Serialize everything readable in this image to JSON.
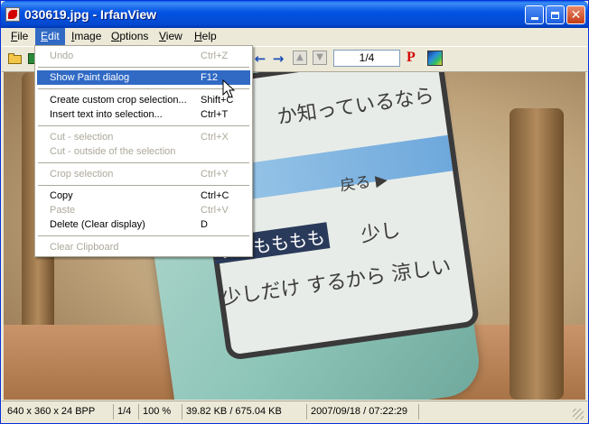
{
  "window": {
    "title": "030619.jpg - IrfanView"
  },
  "menubar": {
    "items": [
      {
        "label": "File",
        "accel": "F",
        "rest": "ile"
      },
      {
        "label": "Edit",
        "accel": "E",
        "rest": "dit"
      },
      {
        "label": "Image",
        "accel": "I",
        "rest": "mage"
      },
      {
        "label": "Options",
        "accel": "O",
        "rest": "ptions"
      },
      {
        "label": "View",
        "accel": "V",
        "rest": "iew"
      },
      {
        "label": "Help",
        "accel": "H",
        "rest": "elp"
      }
    ]
  },
  "toolbar": {
    "page_indicator": "1/4",
    "p_label": "P"
  },
  "edit_menu": {
    "items": [
      {
        "label": "Undo",
        "shortcut": "Ctrl+Z",
        "enabled": false
      },
      {
        "label": "Show Paint dialog",
        "shortcut": "F12",
        "enabled": true,
        "highlighted": true
      },
      {
        "label": "Create custom crop selection...",
        "shortcut": "Shift+C",
        "enabled": true
      },
      {
        "label": "Insert text into selection...",
        "shortcut": "Ctrl+T",
        "enabled": true
      },
      {
        "label": "Cut - selection",
        "shortcut": "Ctrl+X",
        "enabled": false
      },
      {
        "label": "Cut - outside of the selection",
        "shortcut": "",
        "enabled": false
      },
      {
        "label": "Crop selection",
        "shortcut": "Ctrl+Y",
        "enabled": false
      },
      {
        "label": "Copy",
        "shortcut": "Ctrl+C",
        "enabled": true
      },
      {
        "label": "Paste",
        "shortcut": "Ctrl+V",
        "enabled": false
      },
      {
        "label": "Delete (Clear display)",
        "shortcut": "D",
        "enabled": true
      },
      {
        "label": "Clear Clipboard",
        "shortcut": "",
        "enabled": false
      }
    ]
  },
  "image_text": {
    "line1": "か知っているなら",
    "line2": "戻る ▶",
    "highlight": "すももももも",
    "line3": "少し",
    "line4": "少しだけ するから 涼しい"
  },
  "statusbar": {
    "dimensions": "640 x 360 x 24 BPP",
    "page": "1/4",
    "zoom": "100 %",
    "size": "39.82 KB / 675.04 KB",
    "datetime": "2007/09/18 / 07:22:29"
  }
}
